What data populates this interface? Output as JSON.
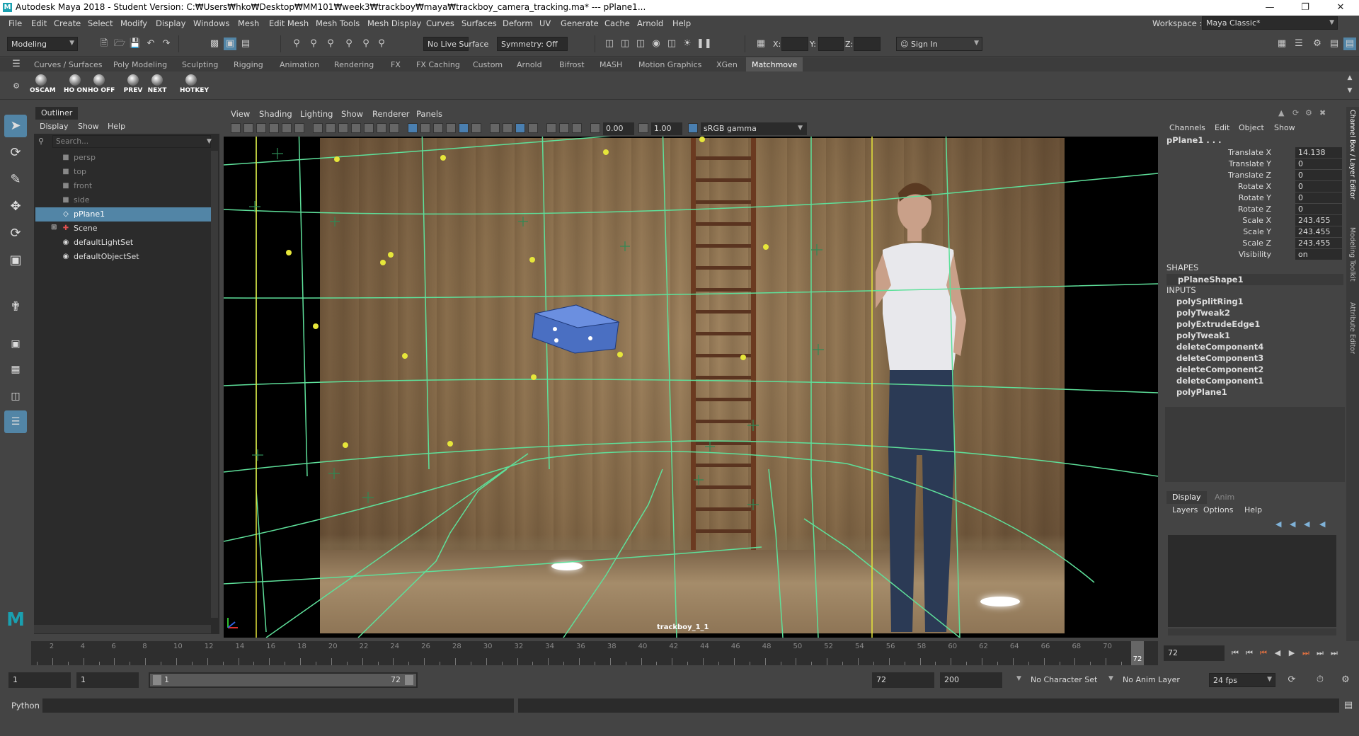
{
  "window": {
    "title": "Autodesk Maya 2018 - Student Version: C:₩Users₩hko₩Desktop₩MM101₩week3₩trackboy₩maya₩trackboy_camera_tracking.ma*   ---   pPlane1...",
    "logo": "M",
    "workspace_label": "Workspace :",
    "workspace_value": "Maya Classic*"
  },
  "menubar": [
    "File",
    "Edit",
    "Create",
    "Select",
    "Modify",
    "Display",
    "Windows",
    "Mesh",
    "Edit Mesh",
    "Mesh Tools",
    "Mesh Display",
    "Curves",
    "Surfaces",
    "Deform",
    "UV",
    "Generate",
    "Cache",
    "Arnold",
    "Help"
  ],
  "statusline": {
    "mode": "Modeling",
    "live_surface": "No Live Surface",
    "symmetry": "Symmetry: Off",
    "x_label": "X:",
    "y_label": "Y:",
    "z_label": "Z:",
    "sign_in": "Sign In"
  },
  "shelf_tabs": [
    "Curves / Surfaces",
    "Poly Modeling",
    "Sculpting",
    "Rigging",
    "Animation",
    "Rendering",
    "FX",
    "FX Caching",
    "Custom",
    "Arnold",
    "Bifrost",
    "MASH",
    "Motion Graphics",
    "XGen",
    "Matchmove"
  ],
  "shelf_active_tab": "Matchmove",
  "shelf_buttons": [
    "OSCAM",
    "HO ON",
    "HO OFF",
    "PREV",
    "NEXT",
    "HOTKEY"
  ],
  "outliner": {
    "tab": "Outliner",
    "menu": [
      "Display",
      "Show",
      "Help"
    ],
    "search_placeholder": "Search...",
    "items": [
      {
        "label": "persp",
        "dim": true
      },
      {
        "label": "top",
        "dim": true
      },
      {
        "label": "front",
        "dim": true
      },
      {
        "label": "side",
        "dim": true
      },
      {
        "label": "pPlane1",
        "selected": true
      },
      {
        "label": "Scene"
      },
      {
        "label": "defaultLightSet"
      },
      {
        "label": "defaultObjectSet"
      }
    ]
  },
  "viewport": {
    "menu": [
      "View",
      "Shading",
      "Lighting",
      "Show",
      "Renderer",
      "Panels"
    ],
    "exposure": "0.00",
    "gamma": "1.00",
    "color_space": "sRGB gamma",
    "camera_label": "trackboy_1_1"
  },
  "channel_box": {
    "menu": [
      "Channels",
      "Edit",
      "Object",
      "Show"
    ],
    "object": "pPlane1 . . .",
    "channels": [
      {
        "label": "Translate X",
        "value": "14.138"
      },
      {
        "label": "Translate Y",
        "value": "0"
      },
      {
        "label": "Translate Z",
        "value": "0"
      },
      {
        "label": "Rotate X",
        "value": "0"
      },
      {
        "label": "Rotate Y",
        "value": "0"
      },
      {
        "label": "Rotate Z",
        "value": "0"
      },
      {
        "label": "Scale X",
        "value": "243.455"
      },
      {
        "label": "Scale Y",
        "value": "243.455"
      },
      {
        "label": "Scale Z",
        "value": "243.455"
      },
      {
        "label": "Visibility",
        "value": "on"
      }
    ],
    "shapes_header": "SHAPES",
    "shape": "pPlaneShape1",
    "inputs_header": "INPUTS",
    "inputs": [
      "polySplitRing1",
      "polyTweak2",
      "polyExtrudeEdge1",
      "polyTweak1",
      "deleteComponent4",
      "deleteComponent3",
      "deleteComponent2",
      "deleteComponent1",
      "polyPlane1"
    ]
  },
  "layer_editor": {
    "tabs": [
      "Display",
      "Anim"
    ],
    "menu": [
      "Layers",
      "Options",
      "Help"
    ]
  },
  "right_strip": [
    "Channel Box / Layer Editor",
    "Modeling Toolkit",
    "Attribute Editor"
  ],
  "time_slider": {
    "labels": [
      "2",
      "4",
      "6",
      "8",
      "10",
      "12",
      "14",
      "16",
      "18",
      "20",
      "22",
      "24",
      "26",
      "28",
      "30",
      "32",
      "34",
      "36",
      "38",
      "40",
      "42",
      "44",
      "46",
      "48",
      "50",
      "52",
      "54",
      "56",
      "58",
      "60",
      "62",
      "64",
      "66",
      "68",
      "70",
      "72"
    ],
    "current_frame": "72",
    "current_field": "72"
  },
  "range": {
    "start": "1",
    "playback_start": "1",
    "slider_start": "1",
    "slider_end": "72",
    "playback_end": "72",
    "end": "200",
    "character_set": "No Character Set",
    "anim_layer": "No Anim Layer",
    "fps": "24 fps"
  },
  "command_line": {
    "language": "Python"
  }
}
